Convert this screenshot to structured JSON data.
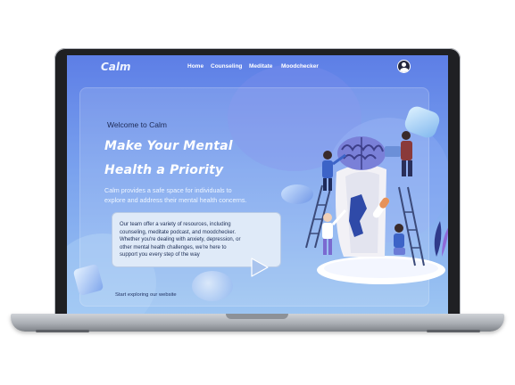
{
  "app": {
    "logo": "Calm"
  },
  "nav": {
    "items": [
      {
        "label": "Home"
      },
      {
        "label": "Counseling"
      },
      {
        "label": "Meditate"
      },
      {
        "label": "Moodchecker"
      }
    ],
    "profile_icon": "user-circle-icon"
  },
  "hero": {
    "welcome": "Welcome to Calm",
    "headline": "Make Your Mental\nHealth a Priority",
    "subtitle": "Calm provides a safe space for individuals to\nexplore and address their mental health concerns.",
    "info": "Our team offer a variety of resources, including\ncounseling, meditate podcast, and moodchecker.\nWhether you're dealing with anxiety, depression, or\nother mental health challenges, we're here to\nsupport you every step of the way",
    "explore_link": "Start exploring our website",
    "play_icon": "play-triangle-icon",
    "illustration": "brain-repair-team-illustration"
  },
  "colors": {
    "screen_top": "#5d7ee6",
    "screen_bottom": "#9cc5f2",
    "heading": "#ffffff",
    "body_text": "#1c2d55",
    "laptop_frame": "#1f2023",
    "laptop_base": "#a9adb3"
  }
}
